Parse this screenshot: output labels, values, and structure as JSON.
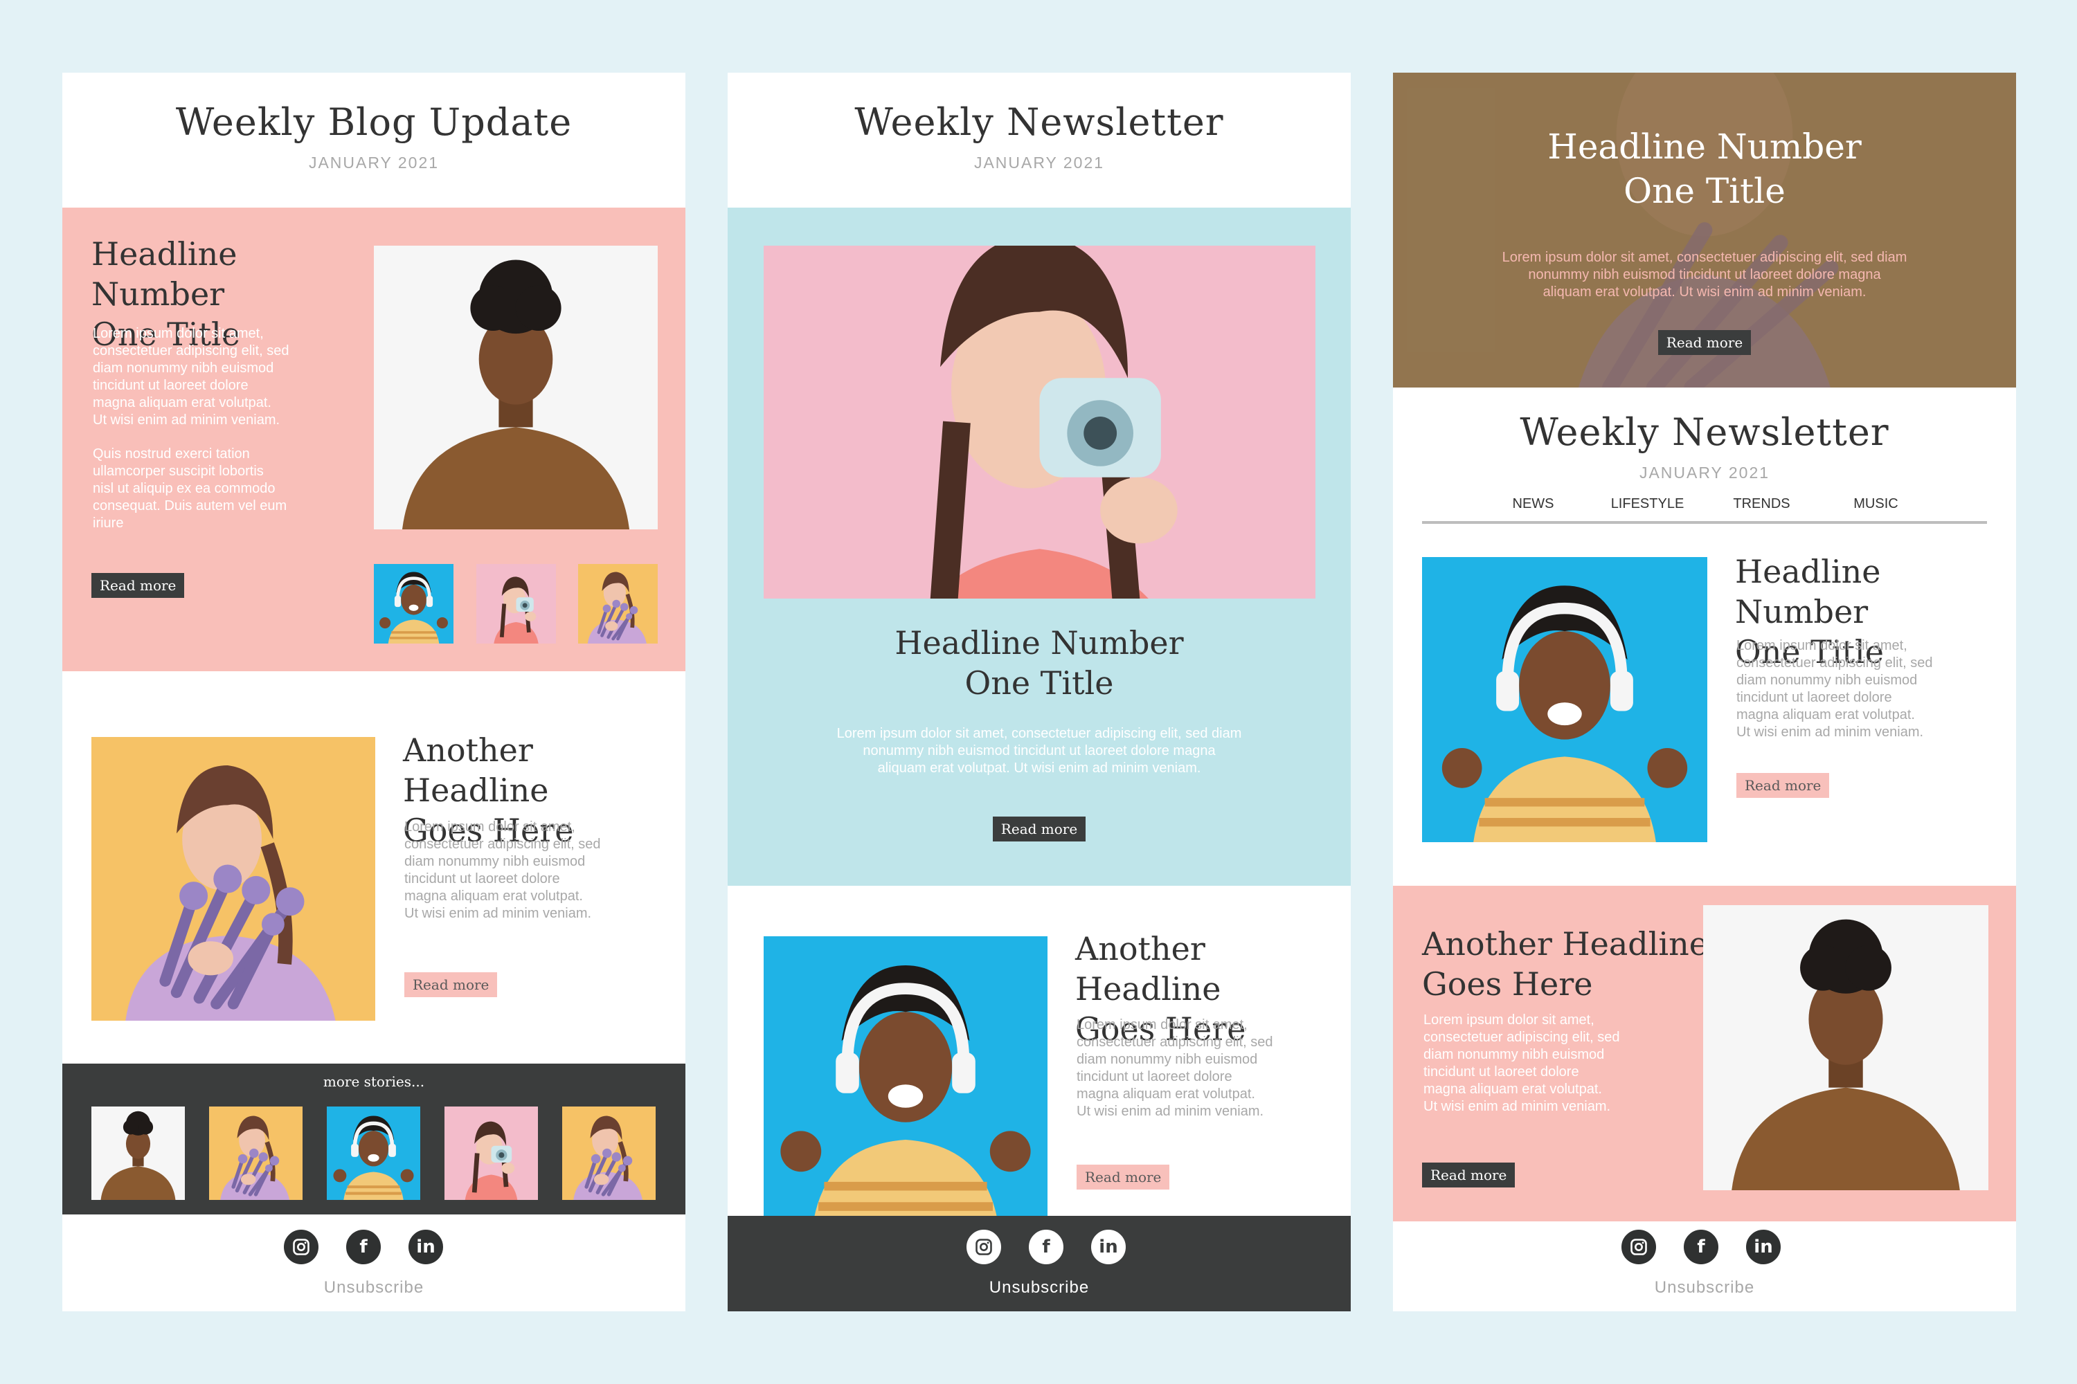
{
  "p1": {
    "title": "Weekly Blog Update",
    "date": "JANUARY 2021",
    "hero": {
      "headline_1": "Headline Number",
      "headline_2": "One Title",
      "para1": [
        "Lorem ipsum dolor sit amet,",
        "consectetuer adipiscing elit, sed",
        "diam nonummy nibh euismod",
        "tincidunt ut laoreet dolore",
        "magna aliquam erat volutpat.",
        "Ut wisi enim ad minim veniam."
      ],
      "para2": [
        "Quis nostrud exerci tation",
        "ullamcorper suscipit lobortis",
        "nisl ut aliquip ex ea commodo",
        "consequat. Duis autem vel eum",
        "iriure"
      ],
      "button": "Read more"
    },
    "second": {
      "headline_1": "Another Headline",
      "headline_2": "Goes Here",
      "para": [
        "Lorem ipsum dolor sit amet,",
        "consectetuer adipiscing elit, sed",
        "diam nonummy nibh euismod",
        "tincidunt ut laoreet dolore",
        "magna aliquam erat volutpat.",
        "Ut wisi enim ad minim veniam."
      ],
      "button": "Read more"
    },
    "more_stories": "more stories...",
    "unsubscribe": "Unsubscribe"
  },
  "p2": {
    "title": "Weekly Newsletter",
    "date": "JANUARY 2021",
    "hero": {
      "headline_1": "Headline Number",
      "headline_2": "One Title",
      "para": [
        "Lorem ipsum dolor sit amet, consectetuer adipiscing elit, sed diam",
        "nonummy nibh euismod tincidunt ut laoreet dolore magna",
        "aliquam erat volutpat. Ut wisi enim ad minim veniam."
      ],
      "button": "Read more"
    },
    "second": {
      "headline_1": "Another Headline",
      "headline_2": "Goes Here",
      "para": [
        "Lorem ipsum dolor sit amet,",
        "consectetuer adipiscing elit, sed",
        "diam nonummy nibh euismod",
        "tincidunt ut laoreet dolore",
        "magna aliquam erat volutpat.",
        "Ut wisi enim ad minim veniam."
      ],
      "button": "Read more"
    },
    "unsubscribe": "Unsubscribe"
  },
  "p3": {
    "banner": {
      "headline_1": "Headline Number",
      "headline_2": "One Title",
      "para": [
        "Lorem ipsum dolor sit amet, consectetuer adipiscing elit, sed diam",
        "nonummy nibh euismod tincidunt ut laoreet dolore magna",
        "aliquam erat volutpat. Ut wisi enim ad minim veniam."
      ],
      "button": "Read more"
    },
    "title": "Weekly Newsletter",
    "date": "JANUARY 2021",
    "nav": [
      "NEWS",
      "LIFESTYLE",
      "TRENDS",
      "MUSIC"
    ],
    "feature": {
      "headline_1": "Headline Number",
      "headline_2": "One Title",
      "para": [
        "Lorem ipsum dolor sit amet,",
        "consectetuer adipiscing elit, sed",
        "diam nonummy nibh euismod",
        "tincidunt ut laoreet dolore",
        "magna aliquam erat volutpat.",
        "Ut wisi enim ad minim veniam."
      ],
      "button": "Read more"
    },
    "second": {
      "headline_1": "Another Headline",
      "headline_2": "Goes Here",
      "para": [
        "Lorem ipsum dolor sit amet,",
        "consectetuer adipiscing elit, sed",
        "diam nonummy nibh euismod",
        "tincidunt ut laoreet dolore",
        "magna aliquam erat volutpat.",
        "Ut wisi enim ad minim veniam."
      ],
      "button": "Read more"
    },
    "unsubscribe": "Unsubscribe"
  },
  "social_icons": {
    "instagram": "instagram-icon",
    "facebook": "f",
    "linkedin": "in"
  },
  "colors": {
    "background": "#e3f2f6",
    "pink": "#f9bfb9",
    "blue": "#bfe5ea",
    "dark": "#3b3d3d",
    "text": "#333333"
  }
}
